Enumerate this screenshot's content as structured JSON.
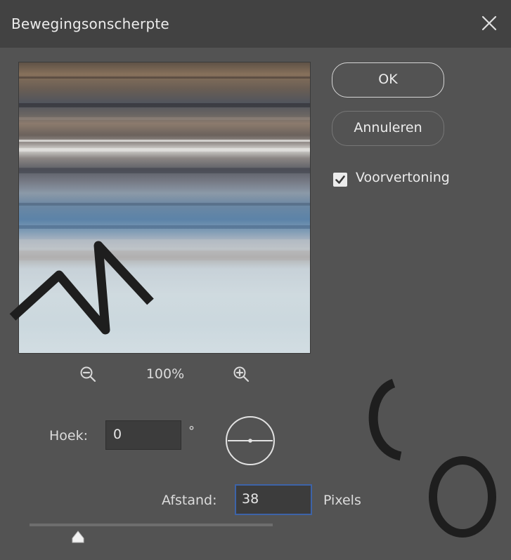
{
  "dialog": {
    "title": "Bewegingsonscherpte",
    "close_icon": "close-icon"
  },
  "preview": {
    "zoom_level": "100%",
    "zoom_out_icon": "zoom-out-icon",
    "zoom_in_icon": "zoom-in-icon"
  },
  "controls": {
    "angle_label": "Hoek:",
    "angle_value": "0",
    "angle_unit": "°",
    "distance_label": "Afstand:",
    "distance_value": "38",
    "distance_unit": "Pixels",
    "distance_slider_fraction": 0.2
  },
  "buttons": {
    "ok_label": "OK",
    "cancel_label": "Annuleren"
  },
  "preview_toggle": {
    "label": "Voorvertoning",
    "checked": true
  },
  "colors": {
    "dialog_background": "#535353",
    "title_bar": "#424242",
    "focus_border": "#3d63a8"
  }
}
